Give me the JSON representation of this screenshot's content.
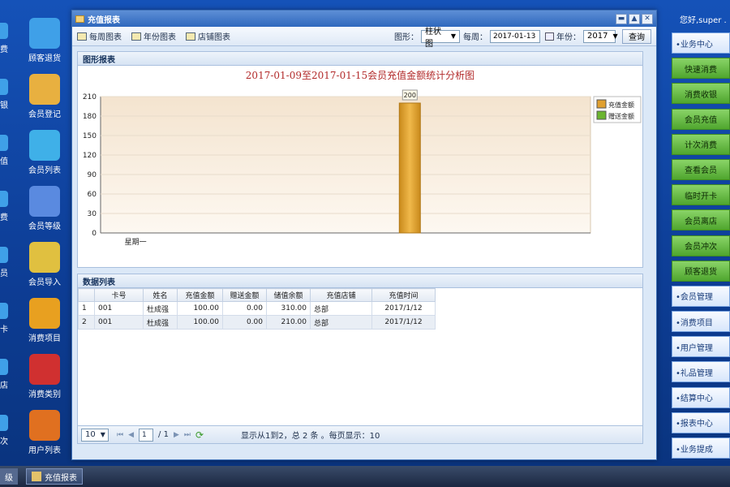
{
  "desktop": {
    "icons": [
      {
        "label": "顾客退货",
        "color": "#3fa0e8"
      },
      {
        "label": "会员登记",
        "color": "#e8b040"
      },
      {
        "label": "会员列表",
        "color": "#3fb0e8"
      },
      {
        "label": "会员等级",
        "color": "#5a8ae0"
      },
      {
        "label": "会员导入",
        "color": "#e0c040"
      },
      {
        "label": "消费项目",
        "color": "#e8a020"
      },
      {
        "label": "消费类别",
        "color": "#d03030"
      },
      {
        "label": "用户列表",
        "color": "#e07020"
      }
    ],
    "left_cut_labels": [
      "费",
      "银",
      "值",
      "费",
      "员",
      "卡",
      "店",
      "次"
    ]
  },
  "greeting": "您好,super .",
  "window": {
    "title": "充值报表",
    "toolbar": {
      "weekly": "每周图表",
      "yearly": "年份图表",
      "store": "店铺图表",
      "chart_type_label": "图形：",
      "chart_type_value": "柱状图",
      "week_label": "每周：",
      "week_value": "2017-01-13",
      "year_label": "年份：",
      "year_value": "2017",
      "query": "查询"
    },
    "chart_panel_title": "图形报表",
    "grid_panel_title": "数据列表",
    "columns": [
      "",
      "卡号",
      "姓名",
      "充值金额",
      "赠送金额",
      "储值余额",
      "充值店铺",
      "充值时间"
    ],
    "rows": [
      [
        "1",
        "001",
        "杜成强",
        "100.00",
        "0.00",
        "310.00",
        "总部",
        "2017/1/12"
      ],
      [
        "2",
        "001",
        "杜成强",
        "100.00",
        "0.00",
        "210.00",
        "总部",
        "2017/1/12"
      ]
    ],
    "pager": {
      "page_size": "10",
      "current_page": "1",
      "total_pages": "/ 1",
      "summary": "显示从1到2，总 2 条 。每页显示：10"
    }
  },
  "chart_data": {
    "type": "bar",
    "title": "2017-01-09至2017-01-15会员充值金额统计分析图",
    "categories": [
      "星期一",
      "",
      "",
      "",
      "",
      "",
      ""
    ],
    "series": [
      {
        "name": "充值金额",
        "values": [
          0,
          0,
          0,
          0,
          200,
          0,
          0
        ],
        "color": "#e0a030"
      },
      {
        "name": "赠送金额",
        "values": [
          0,
          0,
          0,
          0,
          0,
          0,
          0
        ],
        "color": "#6bb52f"
      }
    ],
    "data_labels": [
      "200"
    ],
    "yticks": [
      0,
      30,
      60,
      90,
      120,
      150,
      180,
      210
    ],
    "ylim": [
      0,
      210
    ],
    "legend": "right"
  },
  "rightbar": {
    "items": [
      {
        "label": "•业务中心",
        "style": "blue"
      },
      {
        "label": "快速消费",
        "style": "green"
      },
      {
        "label": "消费收银",
        "style": "green"
      },
      {
        "label": "会员充值",
        "style": "green"
      },
      {
        "label": "计次消费",
        "style": "green"
      },
      {
        "label": "查看会员",
        "style": "green"
      },
      {
        "label": "临时开卡",
        "style": "green"
      },
      {
        "label": "会员离店",
        "style": "green"
      },
      {
        "label": "会员冲次",
        "style": "green"
      },
      {
        "label": "顾客退货",
        "style": "green"
      },
      {
        "label": "•会员管理",
        "style": "blue"
      },
      {
        "label": "•消费项目",
        "style": "blue"
      },
      {
        "label": "•用户管理",
        "style": "blue"
      },
      {
        "label": "•礼品管理",
        "style": "blue"
      },
      {
        "label": "•结算中心",
        "style": "blue"
      },
      {
        "label": "•报表中心",
        "style": "blue"
      },
      {
        "label": "•业务提成",
        "style": "blue"
      }
    ]
  },
  "taskbar": {
    "left_cut": "级",
    "active": "充值报表"
  }
}
